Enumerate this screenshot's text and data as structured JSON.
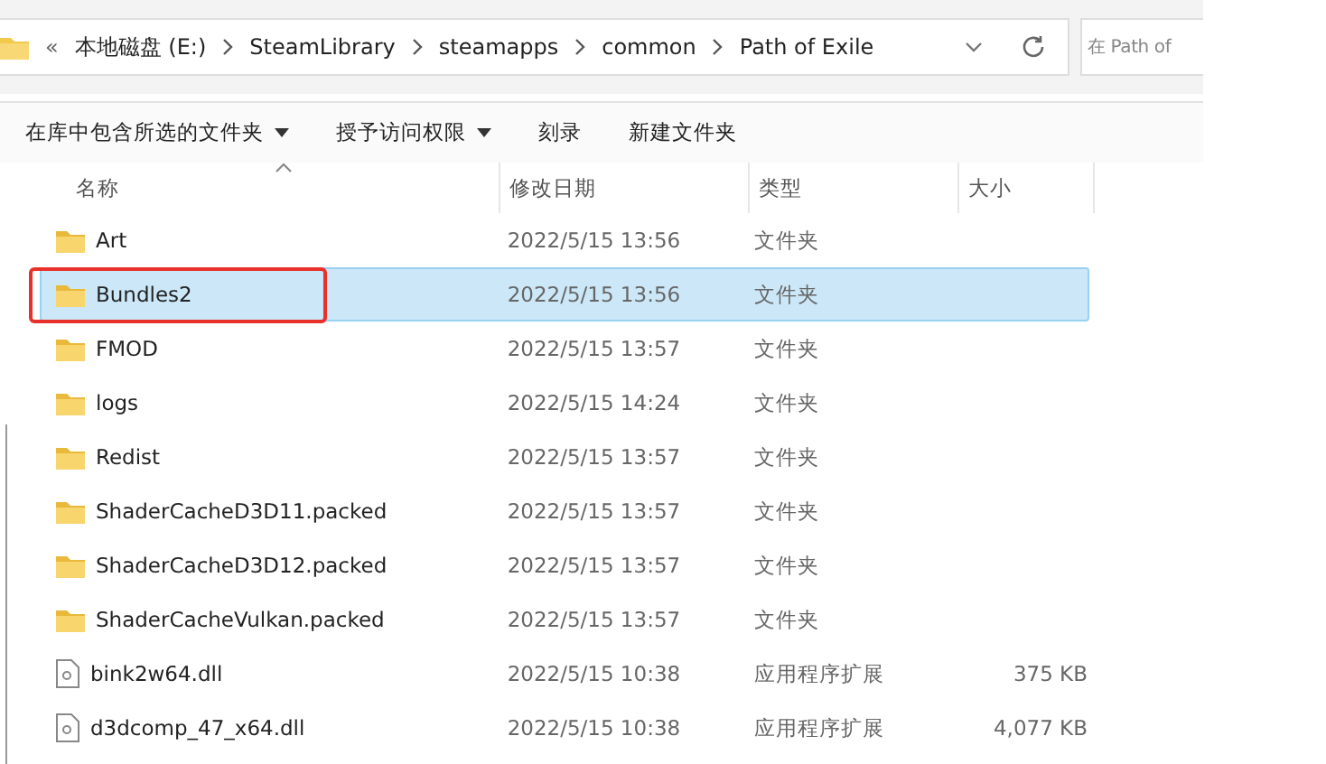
{
  "address_bar": {
    "overflow": "«",
    "crumbs": [
      "本地磁盘 (E:)",
      "SteamLibrary",
      "steamapps",
      "common",
      "Path of Exile"
    ]
  },
  "search": {
    "placeholder": "在 Path of"
  },
  "toolbar": [
    {
      "label": "在库中包含所选的文件夹",
      "dropdown": true
    },
    {
      "label": "授予访问权限",
      "dropdown": true
    },
    {
      "label": "刻录",
      "dropdown": false
    },
    {
      "label": "新建文件夹",
      "dropdown": false
    }
  ],
  "columns": [
    "名称",
    "修改日期",
    "类型",
    "大小"
  ],
  "rows": [
    {
      "name": "Art",
      "date": "2022/5/15 13:56",
      "type": "文件夹",
      "kind": "folder",
      "selected": false,
      "annotated": false
    },
    {
      "name": "Bundles2",
      "date": "2022/5/15 13:56",
      "type": "文件夹",
      "kind": "folder",
      "selected": true,
      "annotated": true
    },
    {
      "name": "FMOD",
      "date": "2022/5/15 13:57",
      "type": "文件夹",
      "kind": "folder",
      "selected": false,
      "annotated": false
    },
    {
      "name": "logs",
      "date": "2022/5/15 14:24",
      "type": "文件夹",
      "kind": "folder",
      "selected": false,
      "annotated": false
    },
    {
      "name": "Redist",
      "date": "2022/5/15 13:57",
      "type": "文件夹",
      "kind": "folder",
      "selected": false,
      "annotated": false
    },
    {
      "name": "ShaderCacheD3D11.packed",
      "date": "2022/5/15 13:57",
      "type": "文件夹",
      "kind": "folder",
      "selected": false,
      "annotated": false
    },
    {
      "name": "ShaderCacheD3D12.packed",
      "date": "2022/5/15 13:57",
      "type": "文件夹",
      "kind": "folder",
      "selected": false,
      "annotated": false
    },
    {
      "name": "ShaderCacheVulkan.packed",
      "date": "2022/5/15 13:57",
      "type": "文件夹",
      "kind": "folder",
      "selected": false,
      "annotated": false
    },
    {
      "name": "bink2w64.dll",
      "date": "2022/5/15 10:38",
      "type": "应用程序扩展",
      "size": "375 KB",
      "kind": "dll",
      "selected": false,
      "annotated": false
    },
    {
      "name": "d3dcomp_47_x64.dll",
      "date": "2022/5/15 10:38",
      "type": "应用程序扩展",
      "size": "4,077 KB",
      "kind": "dll",
      "selected": false,
      "annotated": false
    }
  ]
}
